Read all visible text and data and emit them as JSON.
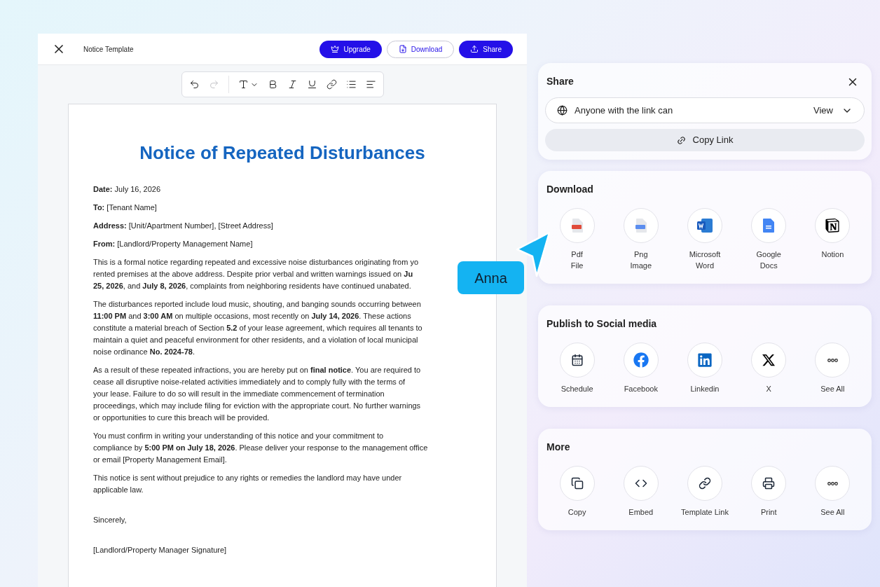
{
  "editor": {
    "title": "Notice Template",
    "buttons": [
      {
        "label": "Upgrade",
        "kind": "upgrade"
      },
      {
        "label": "Download",
        "kind": "download"
      },
      {
        "label": "Share",
        "kind": "share"
      }
    ],
    "toolbar": [
      {
        "kind": "undo",
        "disabled": false
      },
      {
        "kind": "redo",
        "disabled": true
      },
      {
        "kind": "text",
        "disabled": false
      },
      {
        "kind": "bold",
        "disabled": false
      },
      {
        "kind": "italic",
        "disabled": false
      },
      {
        "kind": "underline",
        "disabled": false
      },
      {
        "kind": "link",
        "disabled": false
      },
      {
        "kind": "list",
        "disabled": false
      },
      {
        "kind": "align",
        "disabled": false
      }
    ]
  },
  "document": {
    "title": "Notice of Repeated Disturbances",
    "fields": [
      {
        "label": "Date:",
        "value": "July 16, 2026"
      },
      {
        "label": "To:",
        "value": "[Tenant Name]"
      },
      {
        "label": "Address:",
        "value": "[Unit/Apartment Number], [Street Address]"
      },
      {
        "label": "From:",
        "value": "[Landlord/Property Management Name]"
      }
    ],
    "paragraphs": [
      {
        "lines": [
          "This is a formal notice regarding repeated and excessive noise disturbances originating from yo",
          "rented premises at the above address. Despite prior verbal and written warnings issued on **Ju**",
          "**25, 2026**, and **July 8, 2026**, complaints from neighboring residents have continued unabated."
        ]
      },
      {
        "lines": [
          "The disturbances reported include loud music, shouting, and banging sounds occurring between",
          "**11:00 PM** and **3:00 AM** on multiple occasions, most recently on **July 14, 2026**. These actions",
          "constitute a material breach of Section **5.2** of your lease agreement, which requires all tenants to",
          "maintain a quiet and peaceful environment for other residents, and a violation of local municipal",
          "noise ordinance **No. 2024-78**."
        ]
      },
      {
        "lines": [
          "As a result of these repeated infractions, you are hereby put on **final notice**. You are required to",
          "cease all disruptive noise-related activities immediately and to comply fully with the terms of",
          "your lease. Failure to do so will result in the immediate commencement of termination",
          "proceedings, which may include filing for eviction with the appropriate court. No further warnings",
          "or opportunities to cure this breach will be provided."
        ]
      },
      {
        "lines": [
          "You must confirm in writing your understanding of this notice and your commitment to",
          "compliance by **5:00 PM on July 18, 2026**. Please deliver your response to the management office",
          "or email [Property Management Email]."
        ]
      },
      {
        "lines": [
          "This notice is sent without prejudice to any rights or remedies the landlord may have under",
          "applicable law."
        ]
      }
    ],
    "closing": "Sincerely,",
    "signature": "[Landlord/Property Manager Signature]"
  },
  "cursor": {
    "name": "Anna"
  },
  "share": {
    "title": "Share",
    "access": "Anyone with the link can",
    "permission": "View",
    "copy_button": "Copy Link"
  },
  "sections": [
    {
      "title": "Download",
      "items": [
        {
          "kind": "pdf",
          "lines": [
            "Pdf",
            "File"
          ]
        },
        {
          "kind": "png",
          "lines": [
            "Png",
            "Image"
          ]
        },
        {
          "kind": "word",
          "lines": [
            "Microsoft",
            "Word"
          ]
        },
        {
          "kind": "docs",
          "lines": [
            "Google",
            "Docs"
          ]
        },
        {
          "kind": "notion",
          "lines": [
            "Notion"
          ]
        }
      ]
    },
    {
      "title": "Publish to Social media",
      "items": [
        {
          "kind": "schedule",
          "lines": [
            "Schedule"
          ]
        },
        {
          "kind": "facebook",
          "lines": [
            "Facebook"
          ]
        },
        {
          "kind": "linkedin",
          "lines": [
            "Linkedin"
          ]
        },
        {
          "kind": "x",
          "lines": [
            "X"
          ]
        },
        {
          "kind": "more",
          "lines": [
            "See All"
          ]
        }
      ]
    },
    {
      "title": "More",
      "items": [
        {
          "kind": "copy",
          "lines": [
            "Copy"
          ]
        },
        {
          "kind": "embed",
          "lines": [
            "Embed"
          ]
        },
        {
          "kind": "link",
          "lines": [
            "Template Link"
          ]
        },
        {
          "kind": "print",
          "lines": [
            "Print"
          ]
        },
        {
          "kind": "more",
          "lines": [
            "See All"
          ]
        }
      ]
    }
  ]
}
